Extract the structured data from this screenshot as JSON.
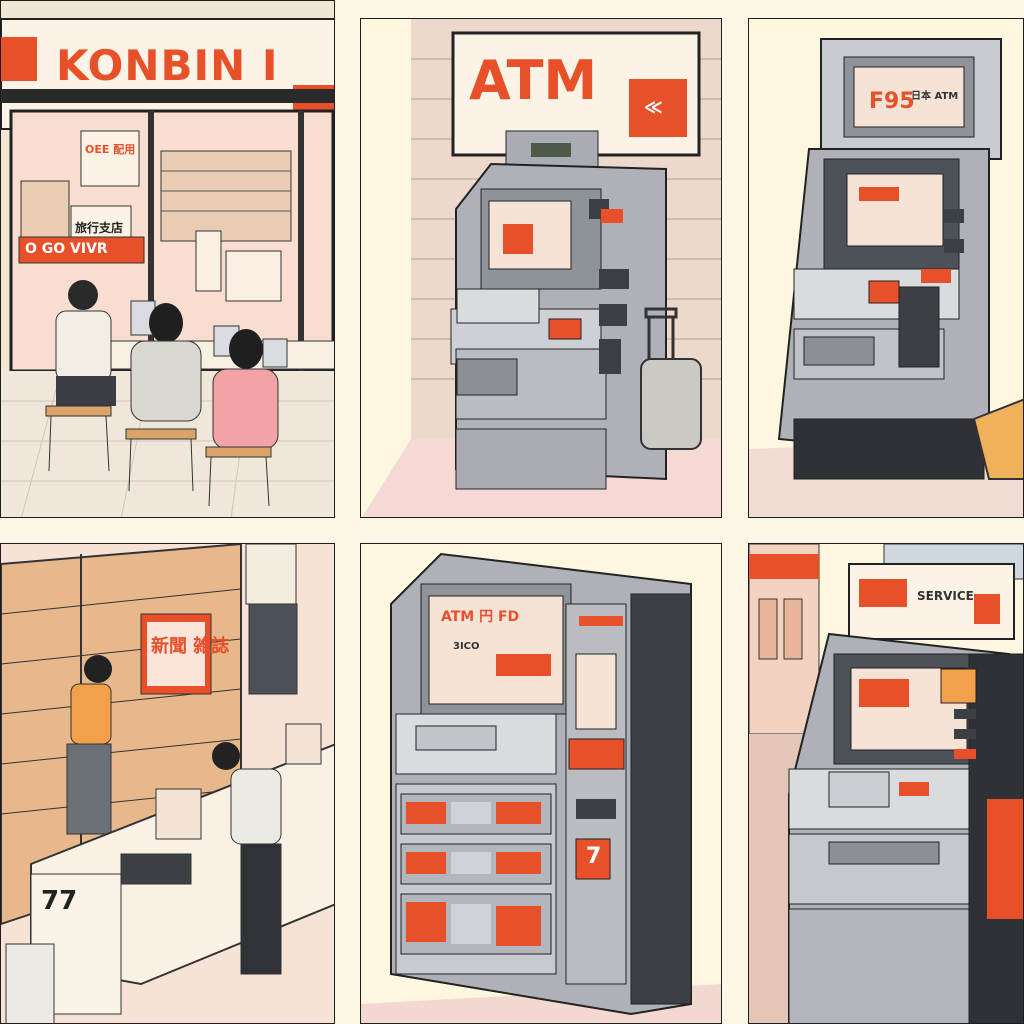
{
  "panels": {
    "store": {
      "sign": "KONBIN I",
      "window_banner": "O GO VIVR",
      "poster_top": "ОЕЕ 配用",
      "poster_mid": "旅行支店",
      "counter_sign": "77"
    },
    "atm_wall": {
      "sign": "ATM",
      "sign_mark": "≪"
    },
    "atm_kiosk": {
      "top_screen": "F95",
      "top_screen_caption": "日本 ATM"
    },
    "store_interior": {
      "shelf_sign": "新聞 雑誌"
    },
    "atm_shelf": {
      "screen_header": "ATM 円 FD",
      "screen_line": "3ICO",
      "side_logo": "7"
    },
    "atm_shop": {
      "top_sign": "SERVICE"
    }
  },
  "colors": {
    "accent_red": "#e8502a",
    "metal_gray": "#a9adb3",
    "dark_gray": "#3c3f44",
    "paper": "#fdf7df"
  }
}
